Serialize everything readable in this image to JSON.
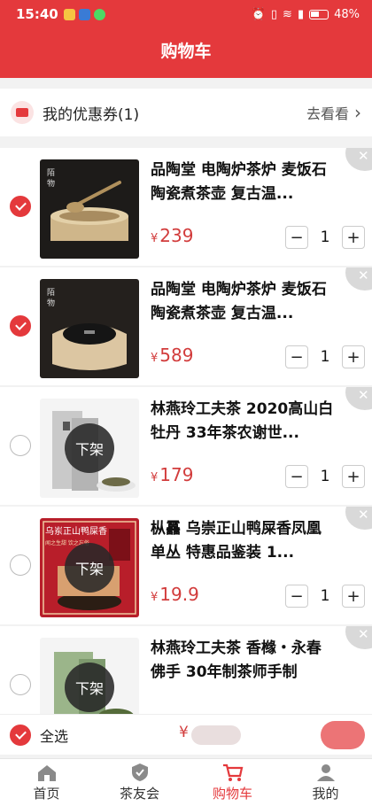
{
  "status_bar": {
    "time": "15:40",
    "battery": "48%"
  },
  "header": {
    "title": "购物车"
  },
  "coupon": {
    "label": "我的优惠券(1)",
    "link": "去看看"
  },
  "items": [
    {
      "name": "品陶堂 电陶炉茶炉 麦饭石陶瓷煮茶壶 复古温...",
      "price_symbol": "¥",
      "price": "239",
      "qty": "1",
      "selected": true,
      "off_shelf_label": ""
    },
    {
      "name": "品陶堂 电陶炉茶炉 麦饭石陶瓷煮茶壶 复古温...",
      "price_symbol": "¥",
      "price": "589",
      "qty": "1",
      "selected": true,
      "off_shelf_label": ""
    },
    {
      "name": "林燕玲工夫茶 2020高山白牡丹 33年茶农谢世...",
      "price_symbol": "¥",
      "price": "179",
      "qty": "1",
      "selected": false,
      "off_shelf_label": "下架"
    },
    {
      "name": "枞靐 乌崇正山鸭屎香凤凰单丛 特惠品鉴装 1...",
      "price_symbol": "¥",
      "price": "19.9",
      "qty": "1",
      "selected": false,
      "off_shelf_label": "下架",
      "thumb_text": [
        "乌岽正山鸭屎香",
        "闻之生甜 饮之忘俗"
      ]
    },
    {
      "name": "林燕玲工夫茶 香橼・永春佛手 30年制茶师手制",
      "price_symbol": "",
      "price": "",
      "qty": "",
      "selected": false,
      "off_shelf_label": "下架"
    }
  ],
  "bottom_bar": {
    "select_all": "全选",
    "total_prefix": "¥"
  },
  "tabs": [
    {
      "label": "首页",
      "icon": "home-icon"
    },
    {
      "label": "茶友会",
      "icon": "shield-check-icon"
    },
    {
      "label": "购物车",
      "icon": "cart-icon",
      "active": true
    },
    {
      "label": "我的",
      "icon": "user-icon"
    }
  ],
  "colors": {
    "brand": "#e4393c",
    "price": "#d23c3c"
  }
}
